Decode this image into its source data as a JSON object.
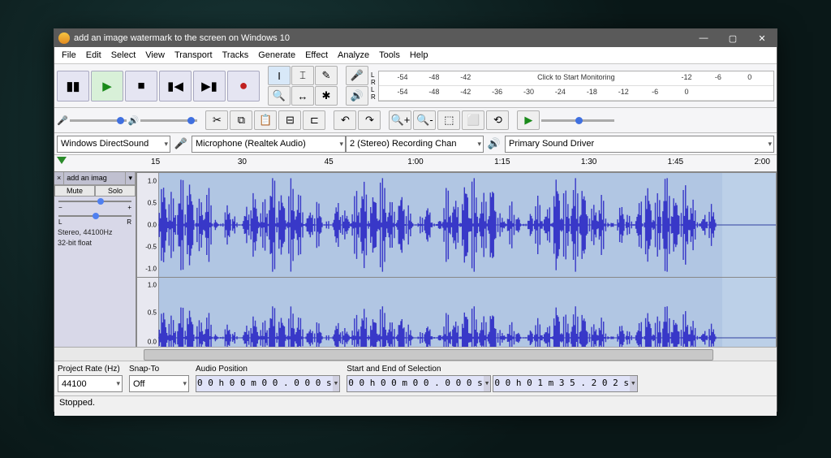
{
  "window": {
    "title": "add an image watermark to the screen on Windows 10"
  },
  "menu": [
    "File",
    "Edit",
    "Select",
    "View",
    "Transport",
    "Tracks",
    "Generate",
    "Effect",
    "Analyze",
    "Tools",
    "Help"
  ],
  "meters": {
    "ticks": [
      "-54",
      "-48",
      "-42",
      "-36",
      "-30",
      "-24",
      "-18",
      "-12",
      "-6",
      "0"
    ],
    "rec_hint": "Click to Start Monitoring"
  },
  "devices": {
    "host": "Windows DirectSound",
    "input": "Microphone (Realtek Audio)",
    "channels": "2 (Stereo) Recording Chan",
    "output": "Primary Sound Driver"
  },
  "timeline": [
    "15",
    "30",
    "45",
    "1:00",
    "1:15",
    "1:30",
    "1:45",
    "2:00"
  ],
  "track": {
    "name": "add an imag",
    "btn_mute": "Mute",
    "btn_solo": "Solo",
    "pan_l": "L",
    "pan_r": "R",
    "info1": "Stereo, 44100Hz",
    "info2": "32-bit float",
    "scale": [
      "1.0",
      "0.5",
      "0.0",
      "-0.5",
      "-1.0"
    ],
    "scale2": [
      "1.0",
      "0.5",
      "0.0"
    ]
  },
  "bottom": {
    "rate_lbl": "Project Rate (Hz)",
    "rate": "44100",
    "snap_lbl": "Snap-To",
    "snap": "Off",
    "pos_lbl": "Audio Position",
    "pos": "0 0 h 0 0 m 0 0 . 0 0 0 s",
    "sel_lbl": "Start and End of Selection",
    "sel_start": "0 0 h 0 0 m 0 0 . 0 0 0 s",
    "sel_end": "0 0 h 0 1 m 3 5 . 2 0 2 s"
  },
  "status": "Stopped."
}
